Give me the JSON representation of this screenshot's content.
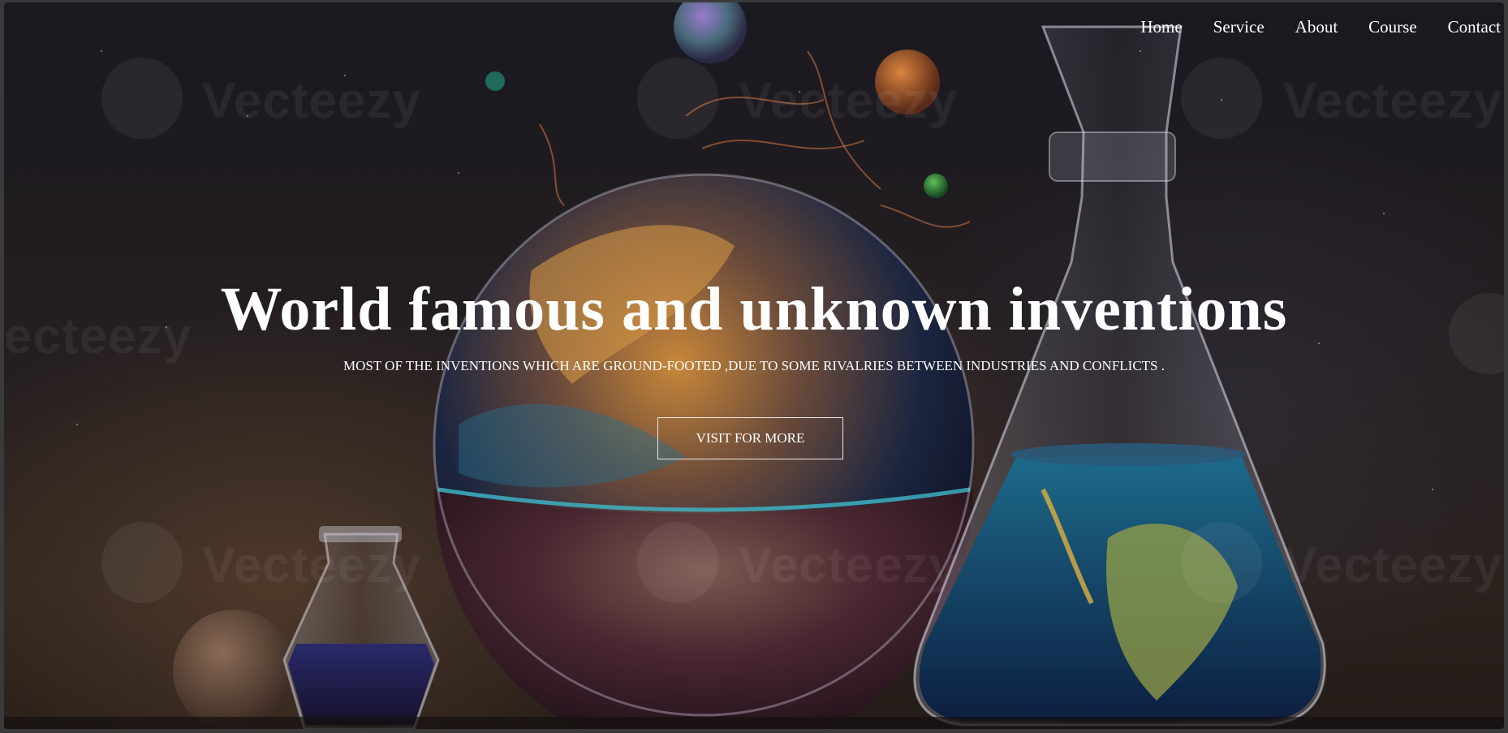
{
  "nav": {
    "items": [
      {
        "label": "Home"
      },
      {
        "label": "Service"
      },
      {
        "label": "About"
      },
      {
        "label": "Course"
      },
      {
        "label": "Contact"
      }
    ]
  },
  "hero": {
    "title": "World famous and unknown inventions",
    "subtitle": "MOST OF THE INVENTIONS WHICH ARE GROUND-FOOTED ,DUE TO SOME RIVALRIES BETWEEN INDUSTRIES AND CONFLICTS .",
    "cta_label": "VISIT FOR MORE"
  },
  "watermark": {
    "text": "Vecteezy",
    "partial_text": "ecteezy"
  },
  "colors": {
    "text": "#ffffff",
    "button_border": "#e8e8e8",
    "background_dark": "#1a1920"
  }
}
